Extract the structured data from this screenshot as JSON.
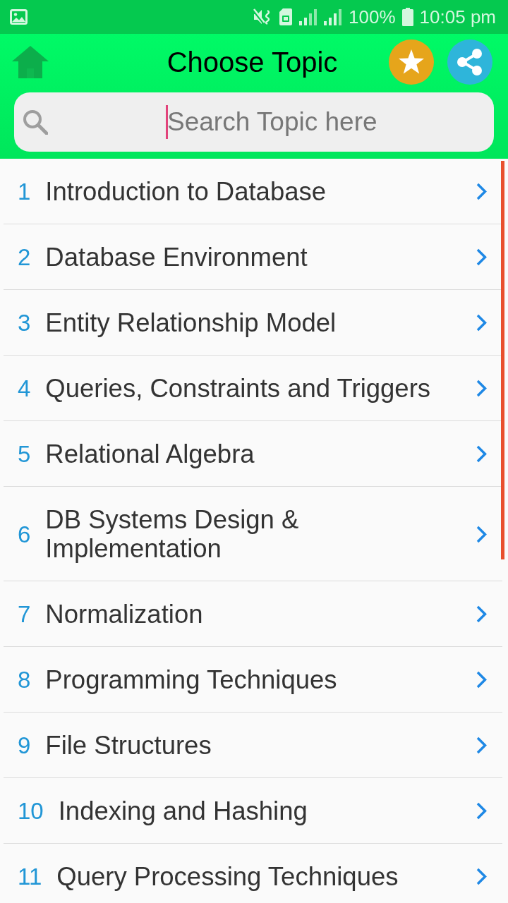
{
  "status_bar": {
    "battery": "100%",
    "time": "10:05 pm"
  },
  "app_bar": {
    "title": "Choose Topic"
  },
  "search": {
    "placeholder": "Search Topic here",
    "focused": true
  },
  "topics": [
    {
      "number": "1",
      "title": "Introduction to Database"
    },
    {
      "number": "2",
      "title": "Database Environment"
    },
    {
      "number": "3",
      "title": "Entity Relationship Model"
    },
    {
      "number": "4",
      "title": "Queries, Constraints and Triggers"
    },
    {
      "number": "5",
      "title": "Relational Algebra"
    },
    {
      "number": "6",
      "title": "DB Systems Design & Implementation"
    },
    {
      "number": "7",
      "title": "Normalization"
    },
    {
      "number": "8",
      "title": "Programming Techniques"
    },
    {
      "number": "9",
      "title": "File Structures"
    },
    {
      "number": "10",
      "title": "Indexing and Hashing"
    },
    {
      "number": "11",
      "title": "Query Processing Techniques"
    }
  ]
}
